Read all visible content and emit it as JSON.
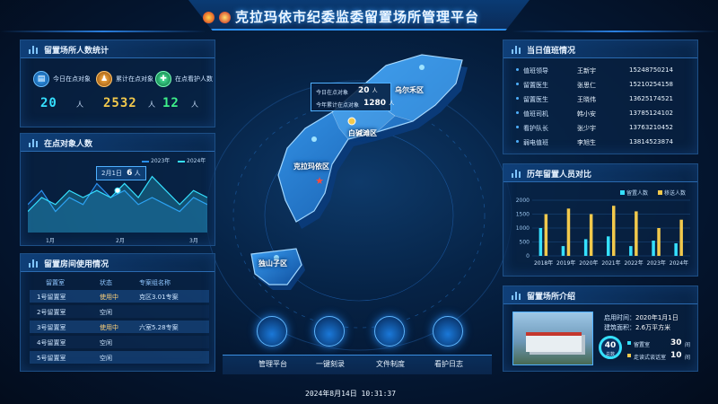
{
  "title": "克拉玛依市纪委监委留置场所管理平台",
  "footer": {
    "datetime": "2024年8月14日  10:31:37"
  },
  "colors": {
    "cyan": "#35e0ff",
    "yellow": "#f2c94c",
    "green": "#3ef08a",
    "accent": "#2a8ff0"
  },
  "left_top": {
    "title": "留置场所人数统计",
    "stats": [
      {
        "label": "今日在点对象",
        "value": "20",
        "unit": "人",
        "icon": "calendar-icon",
        "color": "#35e0ff"
      },
      {
        "label": "累计在点对象",
        "value": "2532",
        "unit": "人",
        "icon": "people-icon",
        "color": "#f2c94c"
      },
      {
        "label": "在点看护人数",
        "value": "12",
        "unit": "人",
        "icon": "guard-icon",
        "color": "#3ef08a"
      }
    ]
  },
  "left_mid": {
    "title": "在点对象人数",
    "tooltip": {
      "date": "2月1日",
      "value": "6",
      "unit": "人"
    },
    "legend": [
      "2023年",
      "2024年"
    ],
    "x_ticks": [
      "1月",
      "2月",
      "3月"
    ],
    "chart_data": {
      "type": "area",
      "x_ticks": [
        "1月",
        "2月",
        "3月"
      ],
      "series": [
        {
          "name": "2023年",
          "values": [
            4,
            6,
            3,
            5,
            4,
            7,
            5,
            6,
            4,
            5,
            4,
            3,
            5,
            4
          ]
        },
        {
          "name": "2024年",
          "values": [
            3,
            5,
            4,
            6,
            5,
            6,
            5,
            7,
            5,
            8,
            6,
            4,
            6,
            5
          ]
        }
      ]
    }
  },
  "left_bot": {
    "title": "留置房间使用情况",
    "headers": [
      "留置室",
      "状态",
      "专案组名称"
    ],
    "rows": [
      {
        "room": "1号留置室",
        "status": "使用中",
        "group": "克区3.01专案"
      },
      {
        "room": "2号留置室",
        "status": "空闲",
        "group": ""
      },
      {
        "room": "3号留置室",
        "status": "使用中",
        "group": "六室5.28专案"
      },
      {
        "room": "4号留置室",
        "status": "空闲",
        "group": ""
      },
      {
        "room": "5号留置室",
        "status": "空闲",
        "group": ""
      }
    ]
  },
  "map": {
    "regions": [
      "乌尔禾区",
      "白碱滩区",
      "克拉玛依区",
      "独山子区"
    ],
    "info": [
      {
        "label": "今日在点对象",
        "value": "20",
        "unit": "人"
      },
      {
        "label": "今年累计在点对象",
        "value": "1280",
        "unit": "人"
      }
    ]
  },
  "dock": [
    {
      "label": "管理平台",
      "icon": "monitor-icon"
    },
    {
      "label": "一键刻录",
      "icon": "disc-icon"
    },
    {
      "label": "文件制度",
      "icon": "document-icon"
    },
    {
      "label": "看护日志",
      "icon": "log-icon"
    }
  ],
  "right_top": {
    "title": "当日值班情况",
    "rows": [
      {
        "role": "值班领导",
        "name": "王新宇",
        "phone": "15248750214"
      },
      {
        "role": "留置医生",
        "name": "张思仁",
        "phone": "15210254158"
      },
      {
        "role": "留置医生",
        "name": "王晓伟",
        "phone": "13625174521"
      },
      {
        "role": "值班司机",
        "name": "韩小安",
        "phone": "13785124102"
      },
      {
        "role": "看护队长",
        "name": "张少宇",
        "phone": "13763210452"
      },
      {
        "role": "弱电值班",
        "name": "李旭生",
        "phone": "13814523874"
      }
    ]
  },
  "right_mid": {
    "title": "历年留置人员对比",
    "chart_data": {
      "type": "bar",
      "categories": [
        "2018年",
        "2019年",
        "2020年",
        "2021年",
        "2022年",
        "2023年",
        "2024年"
      ],
      "series": [
        {
          "name": "留置人数",
          "values": [
            1000,
            350,
            600,
            700,
            350,
            550,
            450
          ]
        },
        {
          "name": "移送人数",
          "values": [
            1500,
            1700,
            1500,
            1800,
            1600,
            1000,
            1300
          ]
        }
      ],
      "ylim": [
        0,
        2000
      ],
      "y_ticks": [
        "0",
        "500",
        "1000",
        "1500",
        "2000"
      ]
    }
  },
  "right_bot": {
    "title": "留置场所介绍",
    "enabled_label": "启用时间：",
    "enabled": "2020年1月1日",
    "area_label": "建筑面积：",
    "area": "2.6万平方米",
    "total": "40",
    "total_label": "总数",
    "items": [
      {
        "label": "留置室",
        "value": "30",
        "unit": "间"
      },
      {
        "label": "走读式谈话室",
        "value": "10",
        "unit": "间"
      }
    ]
  }
}
